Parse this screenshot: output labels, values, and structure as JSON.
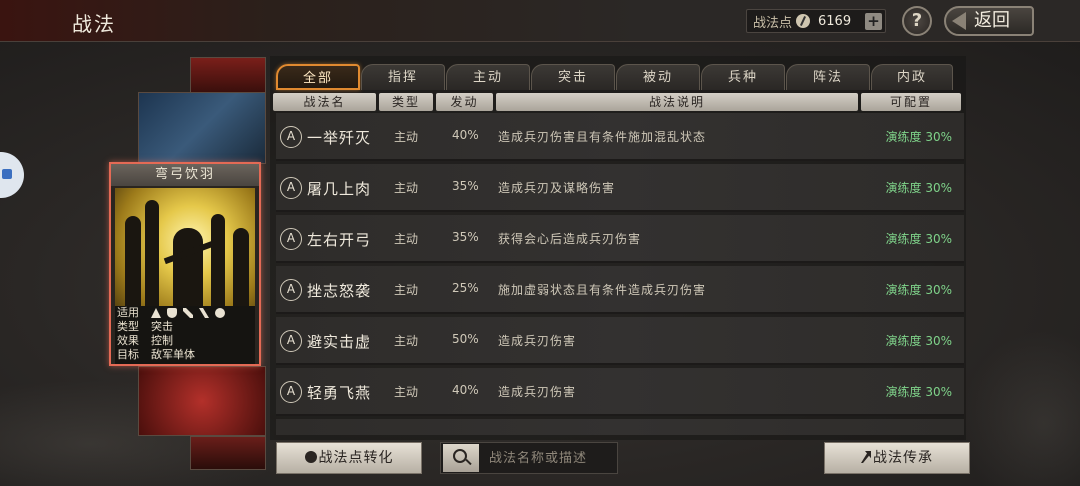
{
  "header": {
    "title": "战法",
    "points_label": "战法点",
    "points_value": "6169",
    "plus": "+",
    "help": "?",
    "back": "返回"
  },
  "tabs": [
    "全部",
    "指挥",
    "主动",
    "突击",
    "被动",
    "兵种",
    "阵法",
    "内政"
  ],
  "columns": [
    "战法名",
    "类型",
    "发动",
    "战法说明",
    "可配置"
  ],
  "skills": [
    {
      "grade": "A",
      "name": "一举歼灭",
      "type": "主动",
      "rate": "40%",
      "desc": "造成兵刃伤害且有条件施加混乱状态",
      "level": "演练度 30%"
    },
    {
      "grade": "A",
      "name": "屠几上肉",
      "type": "主动",
      "rate": "35%",
      "desc": "造成兵刃及谋略伤害",
      "level": "演练度 30%"
    },
    {
      "grade": "A",
      "name": "左右开弓",
      "type": "主动",
      "rate": "35%",
      "desc": "获得会心后造成兵刃伤害",
      "level": "演练度 30%"
    },
    {
      "grade": "A",
      "name": "挫志怒袭",
      "type": "主动",
      "rate": "25%",
      "desc": "施加虚弱状态且有条件造成兵刃伤害",
      "level": "演练度 30%"
    },
    {
      "grade": "A",
      "name": "避实击虚",
      "type": "主动",
      "rate": "50%",
      "desc": "造成兵刃伤害",
      "level": "演练度 30%"
    },
    {
      "grade": "A",
      "name": "轻勇飞燕",
      "type": "主动",
      "rate": "40%",
      "desc": "造成兵刃伤害",
      "level": "演练度 30%"
    }
  ],
  "card": {
    "name": "弯弓饮羽",
    "info": [
      {
        "key": "适用",
        "value": ""
      },
      {
        "key": "类型",
        "value": "突击"
      },
      {
        "key": "效果",
        "value": "控制"
      },
      {
        "key": "目标",
        "value": "敌军单体"
      }
    ],
    "troop_icons": [
      "cavalry-icon",
      "shield-icon",
      "bow-icon",
      "spear-icon",
      "siege-icon"
    ]
  },
  "footer": {
    "convert_label": "战法点转化",
    "search_placeholder": "战法名称或描述",
    "inherit_label": "战法传承"
  }
}
